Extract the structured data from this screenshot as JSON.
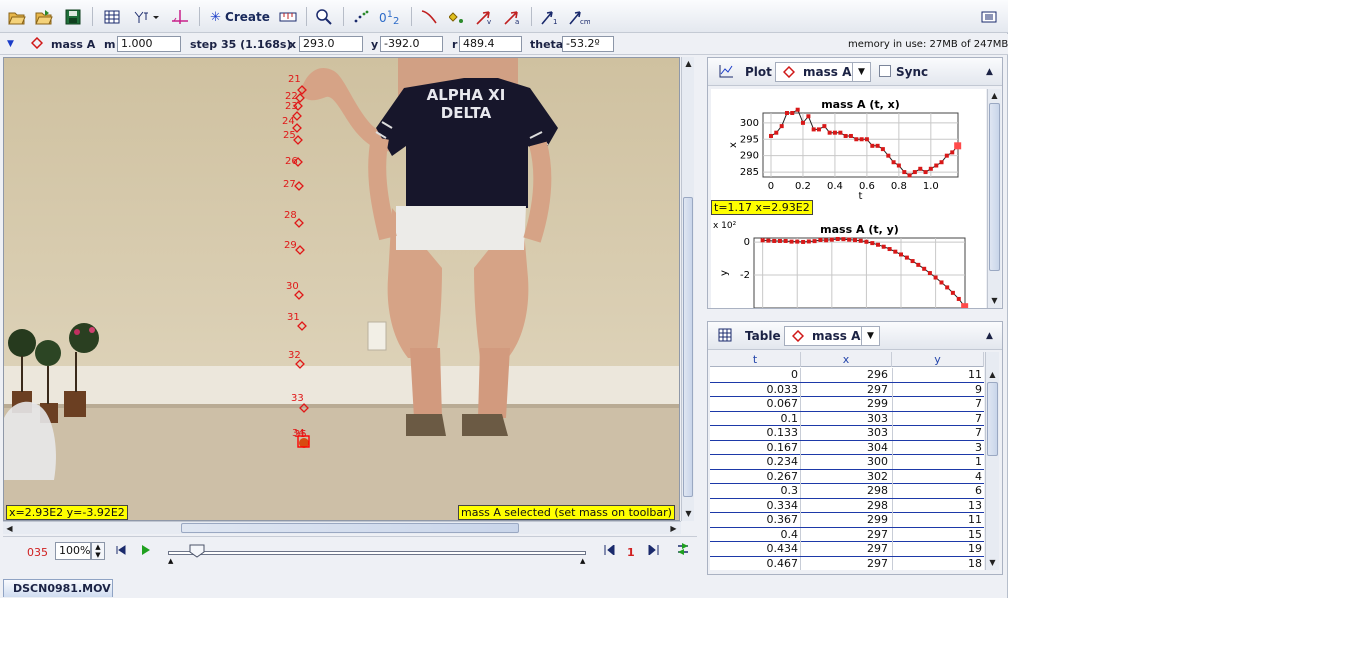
{
  "toolbar": {
    "create_label": "Create"
  },
  "infobar": {
    "mass_name": "mass A",
    "m_label": "m",
    "m_value": "1.000",
    "step_label": "step 35 (1.168s)",
    "x_label": "x",
    "x_value": "293.0",
    "y_label": "y",
    "y_value": "-392.0",
    "r_label": "r",
    "r_value": "489.4",
    "theta_label": "theta",
    "theta_value": "-53.2º",
    "memory": "memory in use: 27MB of 247MB"
  },
  "video": {
    "trail_labels": [
      "21",
      "22",
      "23",
      "24",
      "25",
      "26",
      "27",
      "28",
      "29",
      "30",
      "31",
      "32",
      "33",
      "34",
      "35"
    ],
    "shirt_line1": "ALPHA XI",
    "shirt_line2": "DELTA",
    "coord_readout": "x=2.93E2  y=-3.92E2",
    "status_readout": "mass A selected (set mass on toolbar)"
  },
  "player": {
    "frame_counter": "035",
    "zoom": "100%",
    "step_size": "1",
    "position_fraction": 0.06
  },
  "plot_panel": {
    "tab_label": "Plot",
    "mass_label": "mass A",
    "sync_label": "Sync",
    "readout": "t=1.17  x=2.93E2"
  },
  "table_panel": {
    "tab_label": "Table",
    "mass_label": "mass A",
    "columns": [
      "t",
      "x",
      "y"
    ],
    "rows": [
      [
        "0",
        "296",
        "11"
      ],
      [
        "0.033",
        "297",
        "9"
      ],
      [
        "0.067",
        "299",
        "7"
      ],
      [
        "0.1",
        "303",
        "7"
      ],
      [
        "0.133",
        "303",
        "7"
      ],
      [
        "0.167",
        "304",
        "3"
      ],
      [
        "0.234",
        "300",
        "1"
      ],
      [
        "0.267",
        "302",
        "4"
      ],
      [
        "0.3",
        "298",
        "6"
      ],
      [
        "0.334",
        "298",
        "13"
      ],
      [
        "0.367",
        "299",
        "11"
      ],
      [
        "0.4",
        "297",
        "15"
      ],
      [
        "0.434",
        "297",
        "19"
      ],
      [
        "0.467",
        "297",
        "18"
      ]
    ]
  },
  "file_tab": "DSCN0981.MOV",
  "chart_data": [
    {
      "type": "line",
      "title": "mass A (t, x)",
      "xlabel": "t",
      "ylabel": "x",
      "xlim": [
        -0.05,
        1.17
      ],
      "ylim": [
        283.5,
        303
      ],
      "x_ticks": [
        "0",
        "0.2",
        "0.4",
        "0.6",
        "0.8",
        "1.0"
      ],
      "y_ticks": [
        "285",
        "290",
        "295",
        "300"
      ],
      "x_tick_values": [
        0,
        0.2,
        0.4,
        0.6,
        0.8,
        1.0
      ],
      "y_tick_values": [
        285,
        290,
        295,
        300
      ],
      "series": [
        {
          "x": [
            0,
            0.033,
            0.067,
            0.1,
            0.133,
            0.167,
            0.2,
            0.234,
            0.267,
            0.3,
            0.334,
            0.367,
            0.4,
            0.434,
            0.467,
            0.5,
            0.534,
            0.567,
            0.6,
            0.634,
            0.667,
            0.7,
            0.734,
            0.767,
            0.8,
            0.834,
            0.867,
            0.9,
            0.934,
            0.967,
            1.0,
            1.034,
            1.067,
            1.1,
            1.134,
            1.168
          ],
          "values": [
            296,
            297,
            299,
            303,
            303,
            304,
            300,
            302,
            298,
            298,
            299,
            297,
            297,
            297,
            296,
            296,
            295,
            295,
            295,
            293,
            293,
            292,
            290,
            288,
            287,
            285,
            284,
            285,
            286,
            285,
            286,
            287,
            288,
            290,
            291,
            293
          ]
        }
      ]
    },
    {
      "type": "line",
      "title": "mass A (t, y)",
      "xlabel": "t",
      "ylabel": "y",
      "y_unit_label": "x 10²",
      "xlim": [
        -0.05,
        1.17
      ],
      "ylim": [
        -4.0,
        0.25
      ],
      "y_ticks": [
        "0",
        "-2"
      ],
      "y_tick_values": [
        0,
        -2
      ],
      "series": [
        {
          "x": [
            0,
            0.033,
            0.067,
            0.1,
            0.133,
            0.167,
            0.2,
            0.234,
            0.267,
            0.3,
            0.334,
            0.367,
            0.4,
            0.434,
            0.467,
            0.5,
            0.534,
            0.567,
            0.6,
            0.634,
            0.667,
            0.7,
            0.734,
            0.767,
            0.8,
            0.834,
            0.867,
            0.9,
            0.934,
            0.967,
            1.0,
            1.034,
            1.067,
            1.1,
            1.134,
            1.168
          ],
          "values": [
            0.11,
            0.09,
            0.07,
            0.07,
            0.07,
            0.03,
            0.03,
            0.01,
            0.04,
            0.06,
            0.13,
            0.11,
            0.15,
            0.19,
            0.18,
            0.15,
            0.12,
            0.08,
            0.02,
            -0.06,
            -0.16,
            -0.28,
            -0.42,
            -0.58,
            -0.75,
            -0.94,
            -1.15,
            -1.38,
            -1.62,
            -1.88,
            -2.15,
            -2.45,
            -2.75,
            -3.08,
            -3.45,
            -3.92
          ]
        }
      ]
    }
  ]
}
